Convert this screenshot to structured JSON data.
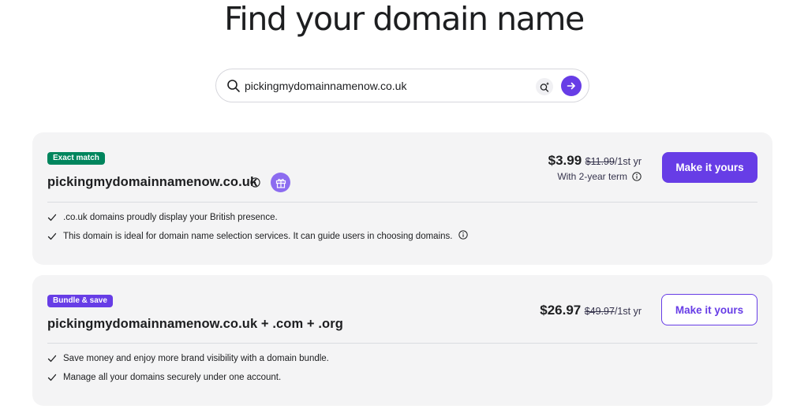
{
  "page": {
    "title": "Find your domain name"
  },
  "search": {
    "value": "pickingmydomainnamenow.co.uk"
  },
  "results": [
    {
      "badge": "Exact match",
      "domain": "pickingmydomainnamenow.co.uk",
      "price": "$3.99",
      "old_price": "$11.99",
      "term": "/1st yr",
      "subtext": "With 2-year term",
      "button": "Make it yours",
      "features": [
        ".co.uk domains proudly display your British presence.",
        "This domain is ideal for domain name selection services. It can guide users in choosing domains."
      ]
    },
    {
      "badge": "Bundle & save",
      "domain": "pickingmydomainnamenow.co.uk + .com + .org",
      "price": "$26.97",
      "old_price": "$49.97",
      "term": "/1st yr",
      "button": "Make it yours",
      "features": [
        "Save money and enjoy more brand visibility with a domain bundle.",
        "Manage all your domains securely under one account."
      ]
    }
  ],
  "colors": {
    "brand": "#673de6",
    "badge_green": "#00855d",
    "card_bg": "#f4f4f5"
  },
  "icons": [
    "search-icon",
    "ai-sparkle-icon",
    "arrow-right-icon",
    "info-icon",
    "gift-icon",
    "check-icon"
  ]
}
